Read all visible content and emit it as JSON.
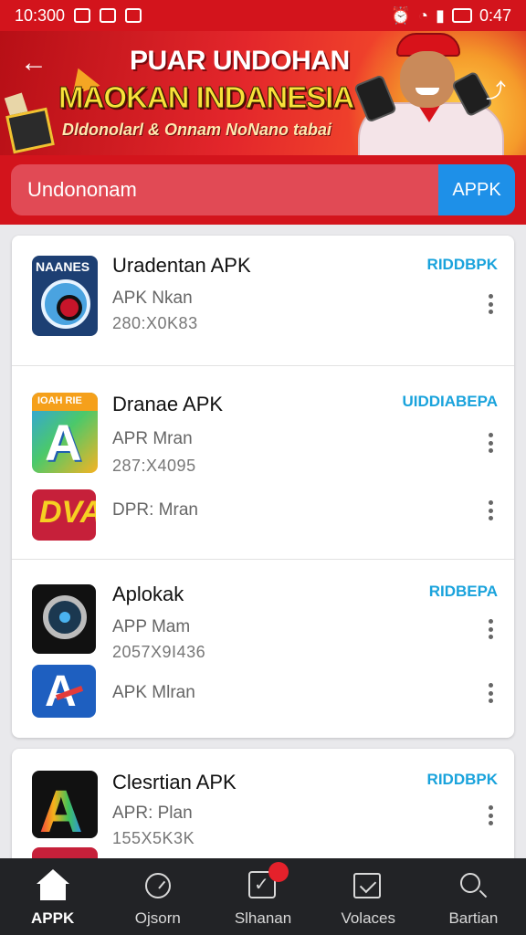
{
  "status_bar": {
    "time": "10:300",
    "right_time": "0:47"
  },
  "banner": {
    "line1": "PUAR UNDOHAN",
    "line2": "MAOKAN INDANESIA",
    "line3": "Dldonolarl & Onnam NoNano tabai"
  },
  "search": {
    "placeholder": "Undononam",
    "button_label": "APPK"
  },
  "apps": [
    {
      "icon_label": "NAANES",
      "title": "Uradentan APK",
      "action": "RIDDBPK",
      "subtitle": "APK Nkan",
      "size": "280:X0K83",
      "icon": "camera-lens-icon"
    },
    {
      "icon_label": "IOAH RIE",
      "title": "Dranae APK",
      "action": "UIDDIABEPA",
      "subtitle": "APR Mran",
      "size": "287:X4095",
      "icon": "letter-a-icon"
    },
    {
      "icon_label": "DVAX",
      "title": "",
      "action": "",
      "subtitle": "DPR: Mran",
      "size": "",
      "icon": "red-logo-icon"
    },
    {
      "icon_label": "",
      "title": "Aplokak",
      "action": "RIDBEPA",
      "subtitle": "APP Mam",
      "size": "2057X9I436",
      "icon": "lens-icon"
    },
    {
      "icon_label": "A",
      "title": "",
      "action": "",
      "subtitle": "APK Mlran",
      "size": "",
      "icon": "letter-a-blue-icon"
    },
    {
      "icon_label": "A",
      "title": "Clesrtian APK",
      "action": "RIDDBPK",
      "subtitle": "APR: Plan",
      "size": "155X5K3K",
      "icon": "letter-a-color-icon"
    }
  ],
  "nav": [
    {
      "label": "APPK",
      "icon": "home-icon"
    },
    {
      "label": "Ojsorn",
      "icon": "clock-icon"
    },
    {
      "label": "Slhanan",
      "icon": "checklist-icon"
    },
    {
      "label": "Volaces",
      "icon": "video-icon"
    },
    {
      "label": "Bartian",
      "icon": "search-icon"
    }
  ]
}
